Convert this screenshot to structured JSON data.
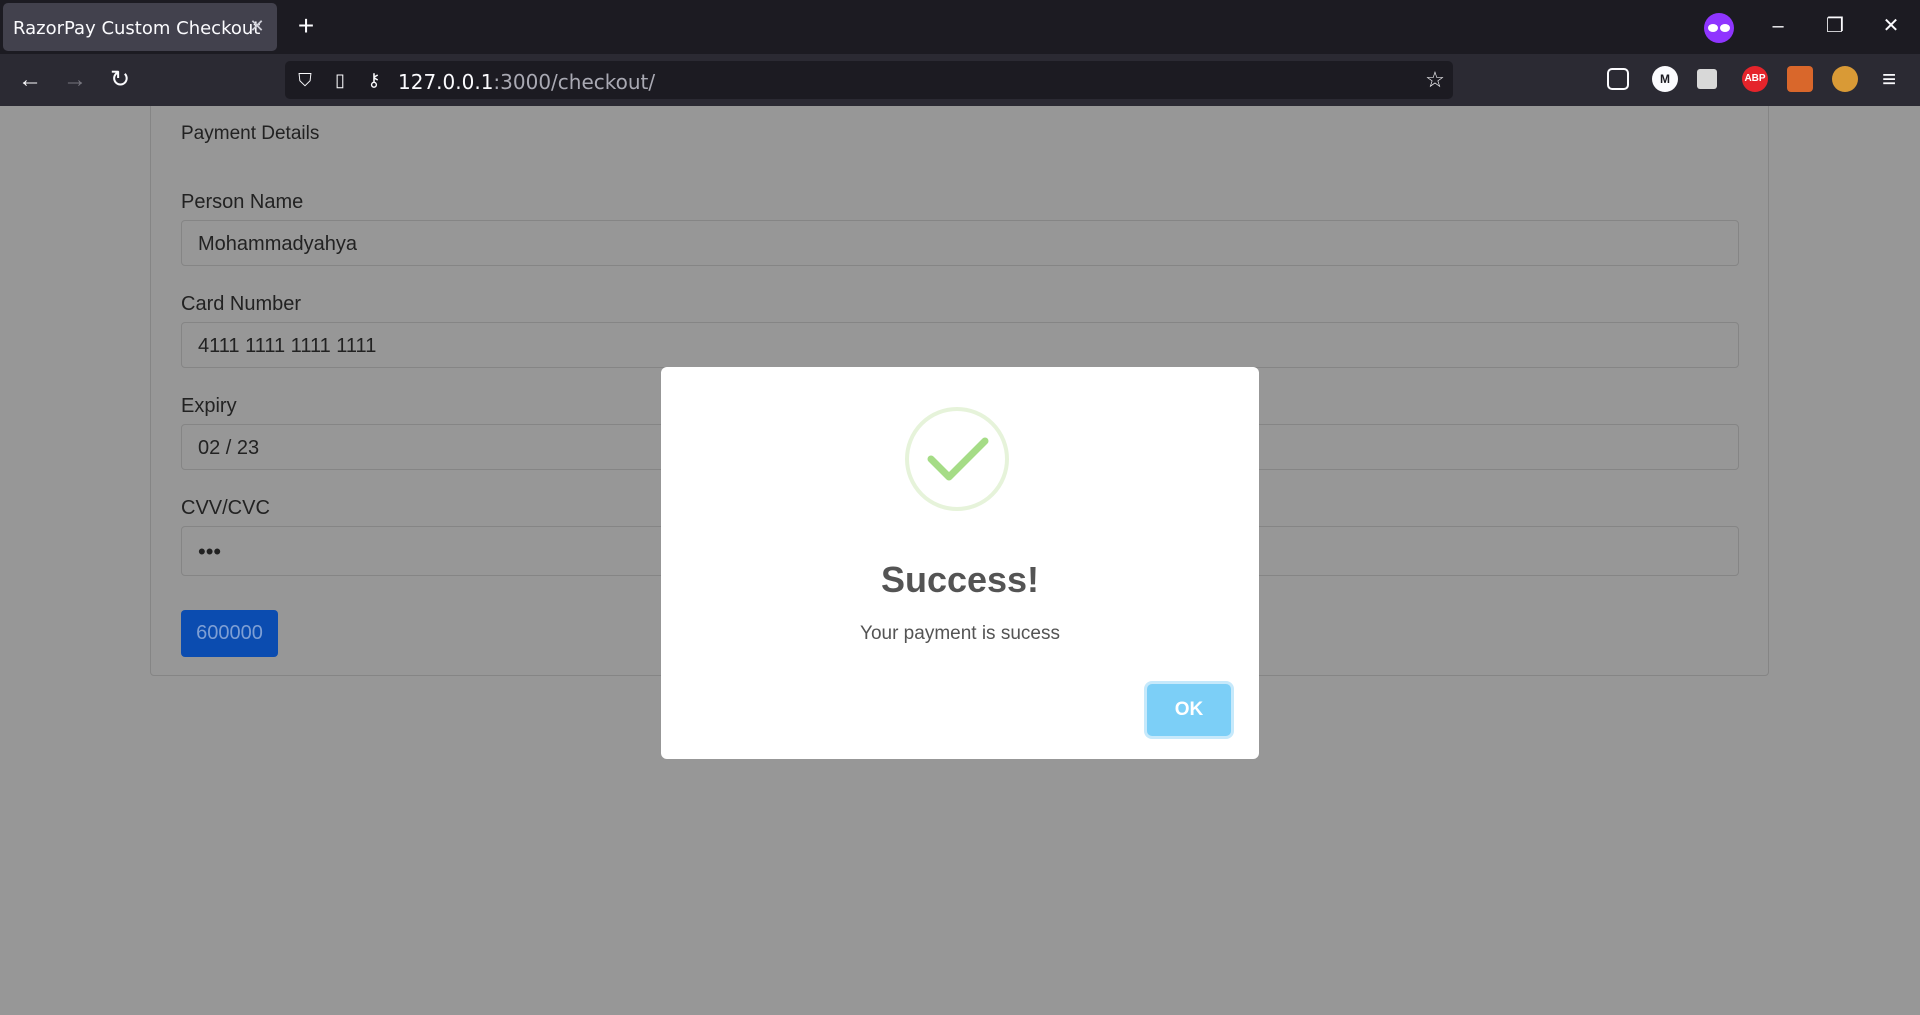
{
  "browser": {
    "tab": {
      "title": "RazorPay Custom Checkout"
    },
    "url": {
      "host": "127.0.0.1",
      "path": ":3000/checkout/"
    },
    "extensions": [
      {
        "name": "pocket-icon",
        "label": ""
      },
      {
        "name": "m-extension-icon",
        "label": "M"
      },
      {
        "name": "calendar-extension-icon",
        "label": ""
      },
      {
        "name": "adblock-plus-icon",
        "label": "ABP"
      },
      {
        "name": "fox-extension-icon",
        "label": ""
      },
      {
        "name": "monkey-extension-icon",
        "label": ""
      }
    ]
  },
  "form": {
    "header": "Payment Details",
    "person_name": {
      "label": "Person Name",
      "value": "Mohammadyahya"
    },
    "card_number": {
      "label": "Card Number",
      "value": "4111 1111 1111 1111"
    },
    "expiry": {
      "label": "Expiry",
      "value": "02 / 23"
    },
    "cvv": {
      "label": "CVV/CVC",
      "value": "•••"
    },
    "pay_button": "600000"
  },
  "modal": {
    "title": "Success!",
    "text": "Your payment is sucess",
    "ok_button": "OK",
    "accent_color": "#a5dc86"
  }
}
